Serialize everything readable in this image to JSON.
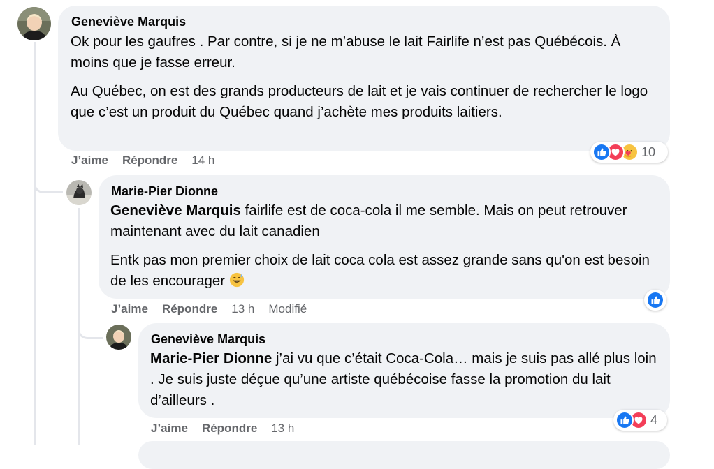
{
  "comments": [
    {
      "author": "Geneviève Marquis",
      "paragraphs": [
        "Ok pour les gaufres . Par contre, si je ne m’abuse le lait Fairlife n’est pas Québécois. À moins que je fasse erreur.",
        "Au Québec, on est des grands producteurs de lait et je vais continuer de rechercher le logo que c’est un produit du Québec quand j’achète mes produits laitiers."
      ],
      "like_label": "J’aime",
      "reply_label": "Répondre",
      "time": "14 h",
      "reaction_count": "10",
      "reactions": [
        "like-icon",
        "love-icon",
        "care-icon"
      ]
    },
    {
      "author": "Marie-Pier Dionne",
      "mention": "Geneviève Marquis",
      "paragraph1_rest": " fairlife est de coca-cola il me semble. Mais on peut retrouver maintenant avec du lait canadien",
      "paragraph2": "Entk pas mon premier choix de lait coca cola est assez grande sans qu'on est besoin de les encourager",
      "emoji": "grinning-sweat-emoji",
      "like_label": "J’aime",
      "reply_label": "Répondre",
      "time": "13 h",
      "edited_label": "Modifié",
      "reactions": [
        "like-icon"
      ]
    },
    {
      "author": "Geneviève Marquis",
      "mention": "Marie-Pier Dionne",
      "paragraph1_rest": " j’ai vu que c’était Coca-Cola… mais je suis pas allé plus loin . Je suis juste déçue qu’une artiste québécoise fasse la promotion du lait d’ailleurs .",
      "like_label": "J’aime",
      "reply_label": "Répondre",
      "time": "13 h",
      "reaction_count": "4",
      "reactions": [
        "like-icon",
        "love-icon"
      ]
    }
  ],
  "colors": {
    "bubble": "#f0f2f5",
    "meta_text": "#65676b",
    "like_blue": "#1877f2",
    "love_red": "#f33e58",
    "thread_line": "#e4e6eb"
  }
}
